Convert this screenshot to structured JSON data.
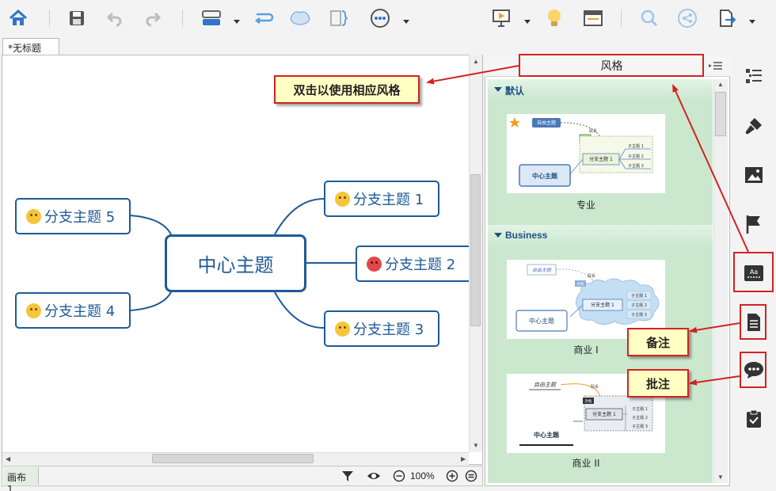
{
  "document": {
    "tab_title": "*无标题"
  },
  "mindmap": {
    "central_topic": "中心主题",
    "branches": [
      {
        "label": "分支主题 1",
        "emoji": "smile-emoji"
      },
      {
        "label": "分支主题 2",
        "emoji": "angry-emoji"
      },
      {
        "label": "分支主题 3",
        "emoji": "sleepy-emoji"
      },
      {
        "label": "分支主题 4",
        "emoji": "neutral-emoji"
      },
      {
        "label": "分支主题 5",
        "emoji": "sleepy-emoji"
      }
    ],
    "line_color": "#1f5a96"
  },
  "statusbar": {
    "sheet_tab": "画布 1",
    "zoom": "100%"
  },
  "style_panel": {
    "title": "风格",
    "groups": [
      {
        "name": "默认",
        "styles": [
          {
            "label": "专业",
            "preview": {
              "floating": "自由主题",
              "central": "中心主题",
              "branch": "分支主题 1",
              "rel": "联系",
              "subtopics": [
                "子主题 1",
                "子主题 2",
                "子主题 3"
              ]
            }
          }
        ]
      },
      {
        "name": "Business",
        "styles": [
          {
            "label": "商业 I",
            "preview": {
              "floating": "自由主题",
              "central": "中心主题",
              "branch": "分支主题 1",
              "rel": "联系",
              "tag": "外框",
              "subtopics": [
                "子主题 1",
                "子主题 2",
                "子主题 3"
              ]
            }
          },
          {
            "label": "商业 II",
            "preview": {
              "floating": "自由主题",
              "central": "中心主题",
              "branch": "分支主题 1",
              "rel": "联系",
              "tag": "外框",
              "subtopics": [
                "子主题 1",
                "子主题 2",
                "子主题 3"
              ]
            }
          }
        ]
      }
    ]
  },
  "annotations": {
    "style_hint": "双击以使用相应风格",
    "notes": "备注",
    "comments": "批注",
    "accent": "#d42222"
  },
  "toolbar_icons": [
    "home-icon",
    "save-icon",
    "undo-icon",
    "redo-icon",
    "topic-icon",
    "relationship-icon",
    "boundary-icon",
    "summary-icon",
    "more-icon",
    "presentation-icon",
    "idea-icon",
    "layout-icon",
    "search-icon",
    "share-icon",
    "export-icon"
  ],
  "sidebar_icons": [
    "outline-icon",
    "format-brush-icon",
    "image-icon",
    "marker-flag-icon",
    "style-icon",
    "notes-icon",
    "comments-icon",
    "task-icon"
  ]
}
